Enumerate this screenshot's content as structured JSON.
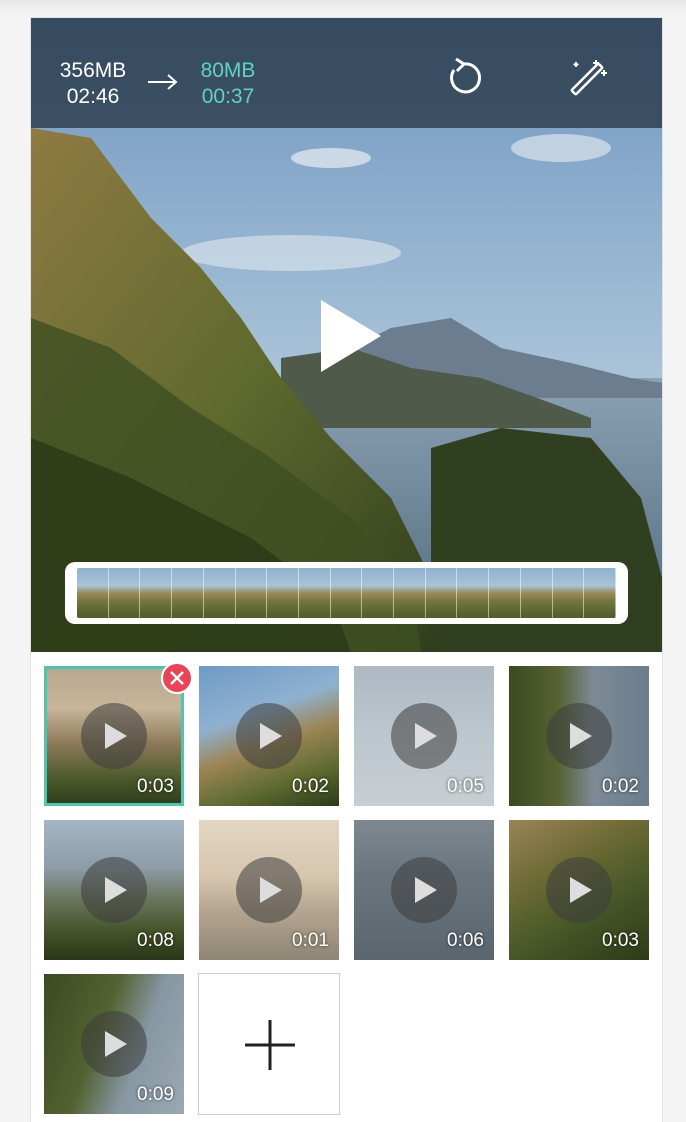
{
  "header": {
    "original_size": "356MB",
    "original_duration": "02:46",
    "new_size": "80MB",
    "new_duration": "00:37"
  },
  "icons": {
    "arrow": "arrow-right-icon",
    "reset": "reset-icon",
    "magic": "magic-wand-icon",
    "play": "play-icon",
    "remove": "close-icon",
    "add": "plus-icon"
  },
  "colors": {
    "accent": "#5fd3c0",
    "remove": "#e8455a",
    "topbar": "#283746"
  },
  "clips": [
    {
      "duration": "0:03",
      "selected": true
    },
    {
      "duration": "0:02",
      "selected": false
    },
    {
      "duration": "0:05",
      "selected": false
    },
    {
      "duration": "0:02",
      "selected": false
    },
    {
      "duration": "0:08",
      "selected": false
    },
    {
      "duration": "0:01",
      "selected": false
    },
    {
      "duration": "0:06",
      "selected": false
    },
    {
      "duration": "0:03",
      "selected": false
    },
    {
      "duration": "0:09",
      "selected": false
    }
  ]
}
